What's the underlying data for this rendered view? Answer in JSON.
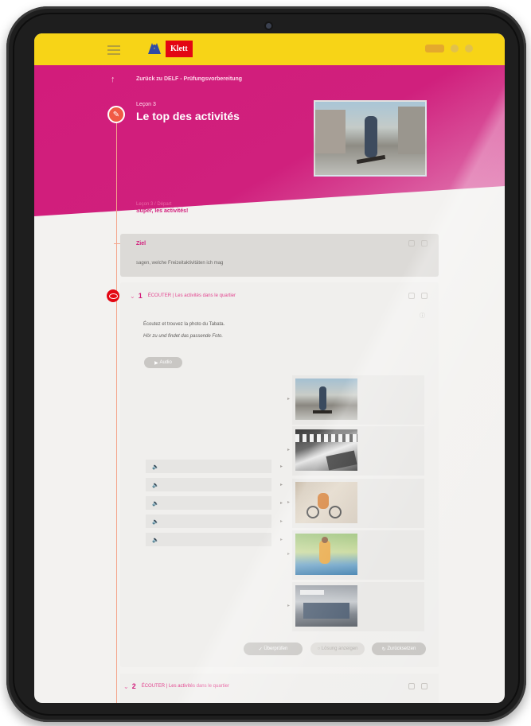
{
  "header": {
    "logo_text": "Klett",
    "menu_icon": "hamburger-icon"
  },
  "hero": {
    "breadcrumb": "Zurück zu DELF - Prüfungsvorbereitung",
    "lesson_label": "Leçon 3",
    "lesson_title": "Le top des activités"
  },
  "section": {
    "sub": "Leçon 3 / Départ",
    "title": "Super, les activités!"
  },
  "ziel": {
    "label": "Ziel",
    "text": "sagen, welche Freizeitaktivitäten ich mag"
  },
  "exercise1": {
    "number": "1",
    "title": "ÉCOUTER | Les activités dans le quartier",
    "instruction_fr": "Écoutez et trouvez la photo du Tabata.",
    "instruction_de": "Hör zu und findet das passende Foto.",
    "audio_button": "Audio",
    "rows": [
      "",
      "",
      "",
      "",
      ""
    ],
    "buttons": {
      "check": "Überprüfen",
      "solution": "Lösung anzeigen",
      "reset": "Zurücksetzen"
    }
  },
  "exercise2": {
    "number": "2",
    "title": "ÉCOUTER | Les activités dans le quartier"
  }
}
